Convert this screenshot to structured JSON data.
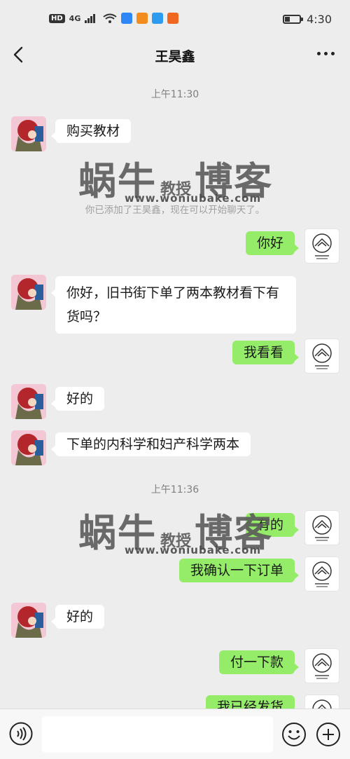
{
  "status_bar": {
    "network_label": "HD",
    "signal_label": "4G",
    "time": "4:30",
    "battery_level": 0.35
  },
  "header": {
    "title": "王昊鑫",
    "back_icon": "chevron-left-icon",
    "more_icon": "more-dots-icon"
  },
  "chat": {
    "timestamp_1": "上午11:30",
    "timestamp_2": "上午11:36",
    "system_message": "你已添加了王昊鑫，现在可以开始聊天了。",
    "messages": [
      {
        "from": "contact",
        "text": "购买教材"
      },
      {
        "from": "me",
        "text": "你好"
      },
      {
        "from": "contact",
        "text": "你好，旧书街下单了两本教材看下有货吗？"
      },
      {
        "from": "me",
        "text": "我看看"
      },
      {
        "from": "contact",
        "text": "好的"
      },
      {
        "from": "contact",
        "text": "下单的内科学和妇产科学两本"
      },
      {
        "from": "me",
        "text": "有的"
      },
      {
        "from": "me",
        "text": "我确认一下订单"
      },
      {
        "from": "contact",
        "text": "好的"
      },
      {
        "from": "me",
        "text": "付一下款"
      },
      {
        "from": "me",
        "text": "我已经发货"
      }
    ]
  },
  "watermark": {
    "brand_left": "蜗牛",
    "brand_mid": "教授",
    "brand_right": "博客",
    "url": "www.woniubake.com"
  },
  "input_bar": {
    "voice_icon": "voice-icon",
    "emoji_icon": "emoji-icon",
    "plus_icon": "plus-icon"
  },
  "colors": {
    "background": "#ededed",
    "my_bubble": "#95ec69",
    "their_bubble": "#ffffff"
  }
}
